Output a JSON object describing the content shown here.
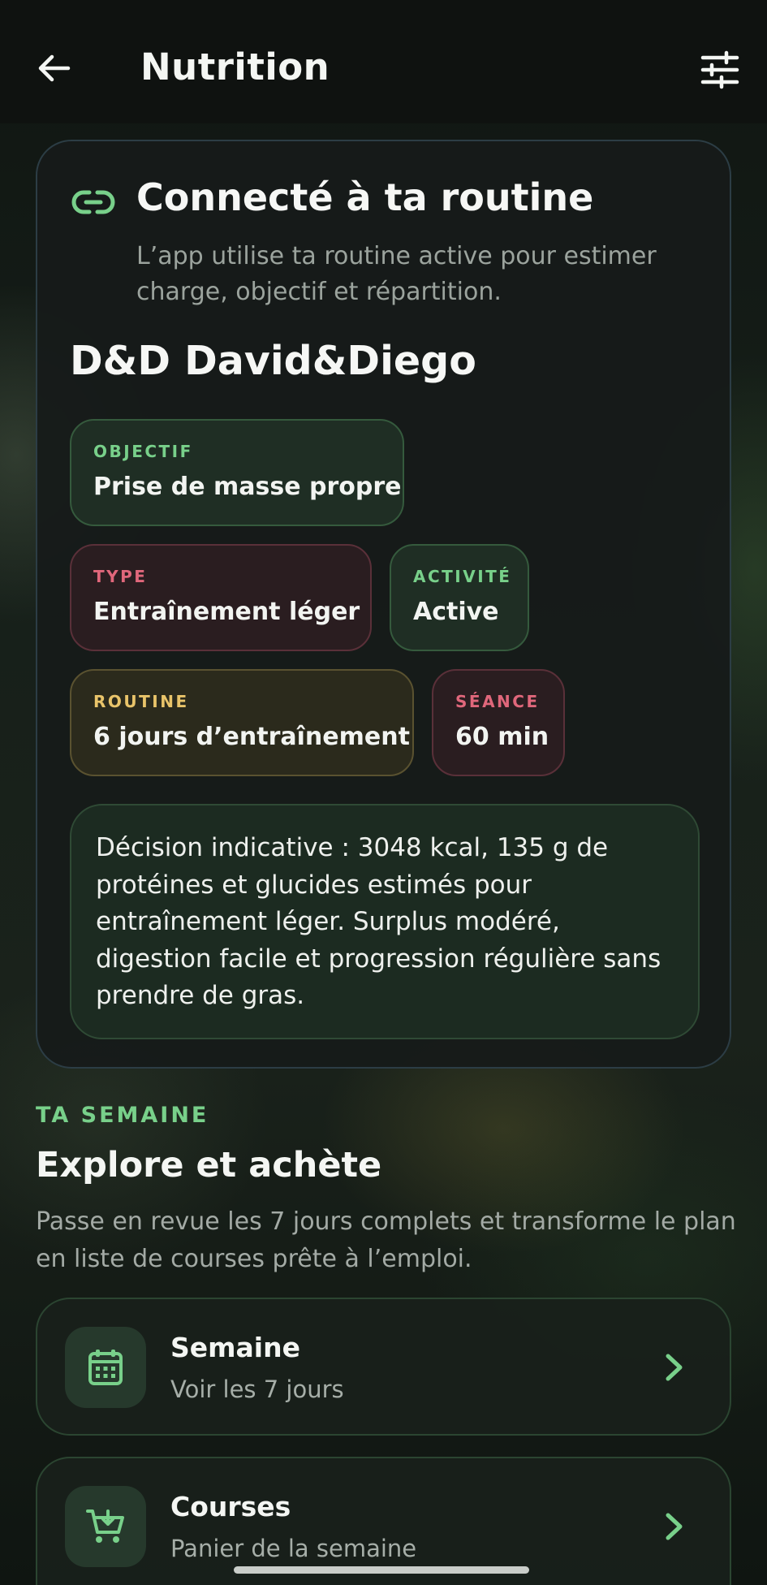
{
  "header": {
    "title": "Nutrition",
    "back_icon": "arrow-left-icon",
    "filter_icon": "sliders-icon"
  },
  "routine_card": {
    "title": "Connecté à ta routine",
    "description": "L’app utilise ta routine active pour estimer charge, objectif et répartition.",
    "routine_name": "D&D David&Diego",
    "chips": [
      {
        "label": "OBJECTIF",
        "value": "Prise de masse propre",
        "tone": "green"
      },
      {
        "label": "TYPE",
        "value": "Entraînement léger",
        "tone": "red"
      },
      {
        "label": "ACTIVITÉ",
        "value": "Active",
        "tone": "green"
      },
      {
        "label": "ROUTINE",
        "value": "6 jours d’entraînement",
        "tone": "yellow"
      },
      {
        "label": "SÉANCE",
        "value": "60 min",
        "tone": "red"
      }
    ],
    "decision": "Décision indicative : 3048 kcal, 135 g de protéines et glucides estimés pour entraînement léger. Surplus modéré, digestion facile et progression régulière sans prendre de gras."
  },
  "week_section": {
    "kicker": "TA SEMAINE",
    "title": "Explore et achète",
    "description": "Passe en revue les 7 jours complets et transforme le plan en liste de courses prête à l’emploi."
  },
  "nav_cards": [
    {
      "title": "Semaine",
      "subtitle": "Voir les 7 jours",
      "icon": "calendar-icon"
    },
    {
      "title": "Courses",
      "subtitle": "Panier de la semaine",
      "icon": "cart-icon"
    }
  ],
  "colors": {
    "accent_green": "#78d08a",
    "accent_red": "#e0677b",
    "accent_yellow": "#e9c46a",
    "background": "#0d130f"
  }
}
